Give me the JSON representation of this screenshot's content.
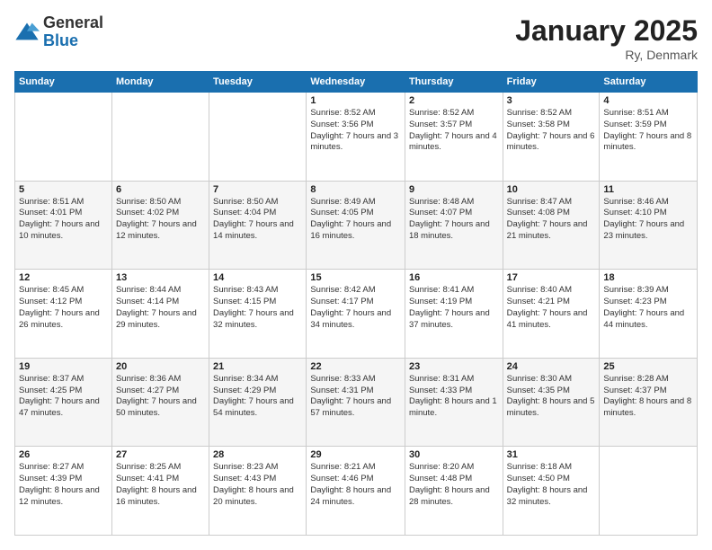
{
  "logo": {
    "general": "General",
    "blue": "Blue"
  },
  "header": {
    "month": "January 2025",
    "location": "Ry, Denmark"
  },
  "weekdays": [
    "Sunday",
    "Monday",
    "Tuesday",
    "Wednesday",
    "Thursday",
    "Friday",
    "Saturday"
  ],
  "weeks": [
    [
      {
        "day": "",
        "sunrise": "",
        "sunset": "",
        "daylight": ""
      },
      {
        "day": "",
        "sunrise": "",
        "sunset": "",
        "daylight": ""
      },
      {
        "day": "",
        "sunrise": "",
        "sunset": "",
        "daylight": ""
      },
      {
        "day": "1",
        "sunrise": "Sunrise: 8:52 AM",
        "sunset": "Sunset: 3:56 PM",
        "daylight": "Daylight: 7 hours and 3 minutes."
      },
      {
        "day": "2",
        "sunrise": "Sunrise: 8:52 AM",
        "sunset": "Sunset: 3:57 PM",
        "daylight": "Daylight: 7 hours and 4 minutes."
      },
      {
        "day": "3",
        "sunrise": "Sunrise: 8:52 AM",
        "sunset": "Sunset: 3:58 PM",
        "daylight": "Daylight: 7 hours and 6 minutes."
      },
      {
        "day": "4",
        "sunrise": "Sunrise: 8:51 AM",
        "sunset": "Sunset: 3:59 PM",
        "daylight": "Daylight: 7 hours and 8 minutes."
      }
    ],
    [
      {
        "day": "5",
        "sunrise": "Sunrise: 8:51 AM",
        "sunset": "Sunset: 4:01 PM",
        "daylight": "Daylight: 7 hours and 10 minutes."
      },
      {
        "day": "6",
        "sunrise": "Sunrise: 8:50 AM",
        "sunset": "Sunset: 4:02 PM",
        "daylight": "Daylight: 7 hours and 12 minutes."
      },
      {
        "day": "7",
        "sunrise": "Sunrise: 8:50 AM",
        "sunset": "Sunset: 4:04 PM",
        "daylight": "Daylight: 7 hours and 14 minutes."
      },
      {
        "day": "8",
        "sunrise": "Sunrise: 8:49 AM",
        "sunset": "Sunset: 4:05 PM",
        "daylight": "Daylight: 7 hours and 16 minutes."
      },
      {
        "day": "9",
        "sunrise": "Sunrise: 8:48 AM",
        "sunset": "Sunset: 4:07 PM",
        "daylight": "Daylight: 7 hours and 18 minutes."
      },
      {
        "day": "10",
        "sunrise": "Sunrise: 8:47 AM",
        "sunset": "Sunset: 4:08 PM",
        "daylight": "Daylight: 7 hours and 21 minutes."
      },
      {
        "day": "11",
        "sunrise": "Sunrise: 8:46 AM",
        "sunset": "Sunset: 4:10 PM",
        "daylight": "Daylight: 7 hours and 23 minutes."
      }
    ],
    [
      {
        "day": "12",
        "sunrise": "Sunrise: 8:45 AM",
        "sunset": "Sunset: 4:12 PM",
        "daylight": "Daylight: 7 hours and 26 minutes."
      },
      {
        "day": "13",
        "sunrise": "Sunrise: 8:44 AM",
        "sunset": "Sunset: 4:14 PM",
        "daylight": "Daylight: 7 hours and 29 minutes."
      },
      {
        "day": "14",
        "sunrise": "Sunrise: 8:43 AM",
        "sunset": "Sunset: 4:15 PM",
        "daylight": "Daylight: 7 hours and 32 minutes."
      },
      {
        "day": "15",
        "sunrise": "Sunrise: 8:42 AM",
        "sunset": "Sunset: 4:17 PM",
        "daylight": "Daylight: 7 hours and 34 minutes."
      },
      {
        "day": "16",
        "sunrise": "Sunrise: 8:41 AM",
        "sunset": "Sunset: 4:19 PM",
        "daylight": "Daylight: 7 hours and 37 minutes."
      },
      {
        "day": "17",
        "sunrise": "Sunrise: 8:40 AM",
        "sunset": "Sunset: 4:21 PM",
        "daylight": "Daylight: 7 hours and 41 minutes."
      },
      {
        "day": "18",
        "sunrise": "Sunrise: 8:39 AM",
        "sunset": "Sunset: 4:23 PM",
        "daylight": "Daylight: 7 hours and 44 minutes."
      }
    ],
    [
      {
        "day": "19",
        "sunrise": "Sunrise: 8:37 AM",
        "sunset": "Sunset: 4:25 PM",
        "daylight": "Daylight: 7 hours and 47 minutes."
      },
      {
        "day": "20",
        "sunrise": "Sunrise: 8:36 AM",
        "sunset": "Sunset: 4:27 PM",
        "daylight": "Daylight: 7 hours and 50 minutes."
      },
      {
        "day": "21",
        "sunrise": "Sunrise: 8:34 AM",
        "sunset": "Sunset: 4:29 PM",
        "daylight": "Daylight: 7 hours and 54 minutes."
      },
      {
        "day": "22",
        "sunrise": "Sunrise: 8:33 AM",
        "sunset": "Sunset: 4:31 PM",
        "daylight": "Daylight: 7 hours and 57 minutes."
      },
      {
        "day": "23",
        "sunrise": "Sunrise: 8:31 AM",
        "sunset": "Sunset: 4:33 PM",
        "daylight": "Daylight: 8 hours and 1 minute."
      },
      {
        "day": "24",
        "sunrise": "Sunrise: 8:30 AM",
        "sunset": "Sunset: 4:35 PM",
        "daylight": "Daylight: 8 hours and 5 minutes."
      },
      {
        "day": "25",
        "sunrise": "Sunrise: 8:28 AM",
        "sunset": "Sunset: 4:37 PM",
        "daylight": "Daylight: 8 hours and 8 minutes."
      }
    ],
    [
      {
        "day": "26",
        "sunrise": "Sunrise: 8:27 AM",
        "sunset": "Sunset: 4:39 PM",
        "daylight": "Daylight: 8 hours and 12 minutes."
      },
      {
        "day": "27",
        "sunrise": "Sunrise: 8:25 AM",
        "sunset": "Sunset: 4:41 PM",
        "daylight": "Daylight: 8 hours and 16 minutes."
      },
      {
        "day": "28",
        "sunrise": "Sunrise: 8:23 AM",
        "sunset": "Sunset: 4:43 PM",
        "daylight": "Daylight: 8 hours and 20 minutes."
      },
      {
        "day": "29",
        "sunrise": "Sunrise: 8:21 AM",
        "sunset": "Sunset: 4:46 PM",
        "daylight": "Daylight: 8 hours and 24 minutes."
      },
      {
        "day": "30",
        "sunrise": "Sunrise: 8:20 AM",
        "sunset": "Sunset: 4:48 PM",
        "daylight": "Daylight: 8 hours and 28 minutes."
      },
      {
        "day": "31",
        "sunrise": "Sunrise: 8:18 AM",
        "sunset": "Sunset: 4:50 PM",
        "daylight": "Daylight: 8 hours and 32 minutes."
      },
      {
        "day": "",
        "sunrise": "",
        "sunset": "",
        "daylight": ""
      }
    ]
  ]
}
